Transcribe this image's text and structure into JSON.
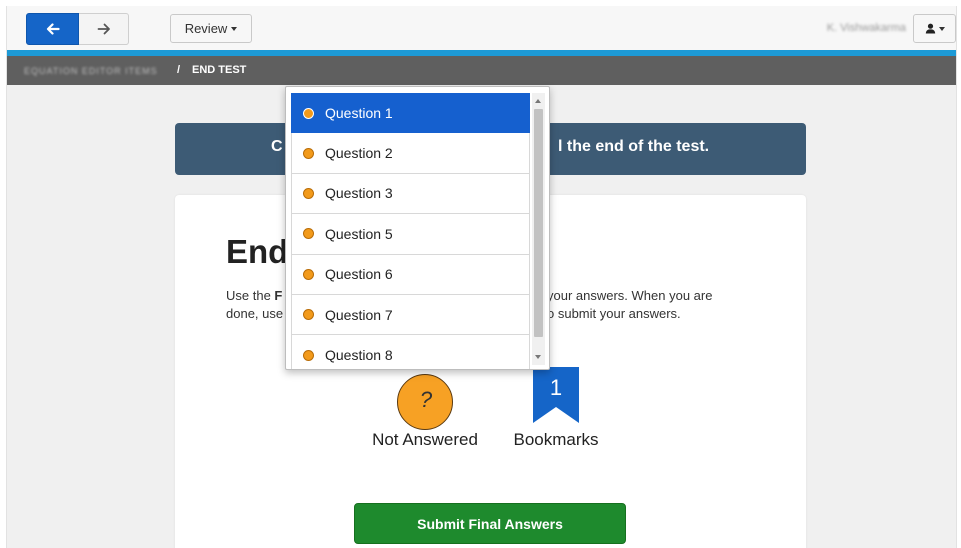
{
  "toolbar": {
    "back_icon": "arrow-left-icon",
    "forward_icon": "arrow-right-icon",
    "review_label": "Review",
    "username": "K. Vishwakarma",
    "user_icon": "user-icon"
  },
  "breadcrumb": {
    "first": "EQUATION EDITOR ITEMS",
    "separator": "/",
    "current": "END TEST"
  },
  "banner": {
    "text_left": "C",
    "text_right": "l the end of the test."
  },
  "card": {
    "heading": "End",
    "line1_a": "Use the ",
    "line1_b": "F",
    "line1_c": " your answers. When you are",
    "line2_a": "done, use",
    "line2_b": "o submit your answers.",
    "not_answered_count": "?",
    "not_answered_label": "Not Answered",
    "bookmarks_count": "1",
    "bookmarks_label": "Bookmarks",
    "submit_label": "Submit Final Answers"
  },
  "dropdown": {
    "items": [
      {
        "label": "Question 1"
      },
      {
        "label": "Question 2"
      },
      {
        "label": "Question 3"
      },
      {
        "label": "Question 5"
      },
      {
        "label": "Question 6"
      },
      {
        "label": "Question 7"
      },
      {
        "label": "Question 8"
      }
    ]
  },
  "colors": {
    "accent_blue": "#1560cf",
    "toolbar_rule": "#1d9ad6",
    "banner": "#3d5b75",
    "submit_green": "#1e8a2d",
    "unanswered_orange": "#f29a1b"
  }
}
